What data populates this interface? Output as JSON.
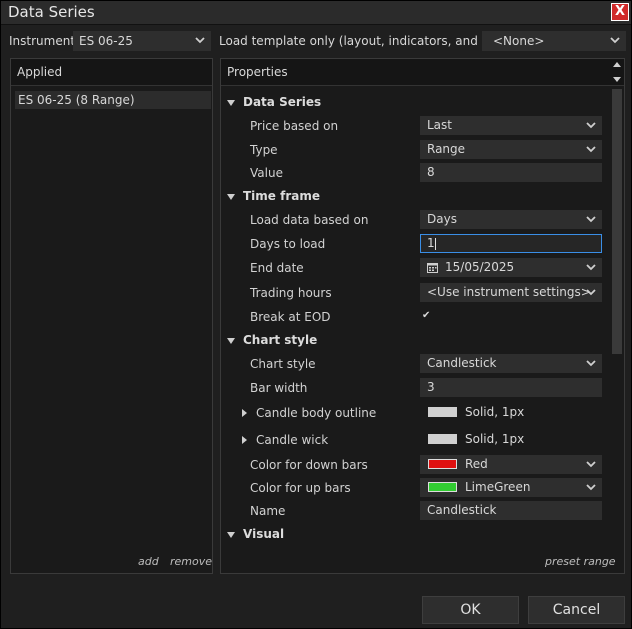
{
  "window": {
    "title": "Data Series",
    "close_glyph": "X"
  },
  "top": {
    "instrument_label": "Instrument",
    "instrument_value": "ES 06-25",
    "template_label": "Load template only (layout, indicators, and style)",
    "template_value": "<None>"
  },
  "applied": {
    "header": "Applied",
    "items": [
      "ES 06-25 (8 Range)"
    ],
    "add_label": "add",
    "remove_label": "remove"
  },
  "properties": {
    "header": "Properties",
    "preset_label": "preset range",
    "sections": {
      "data_series": "Data Series",
      "time_frame": "Time frame",
      "chart_style": "Chart style",
      "visual": "Visual"
    },
    "rows": {
      "price_based_on": {
        "label": "Price based on",
        "value": "Last"
      },
      "type": {
        "label": "Type",
        "value": "Range"
      },
      "value": {
        "label": "Value",
        "value": "8"
      },
      "load_data_based_on": {
        "label": "Load data based on",
        "value": "Days"
      },
      "days_to_load": {
        "label": "Days to load",
        "value": "1"
      },
      "end_date": {
        "label": "End date",
        "value": "15/05/2025"
      },
      "trading_hours": {
        "label": "Trading hours",
        "value": "<Use instrument settings>"
      },
      "break_at_eod": {
        "label": "Break at EOD",
        "value": "✔"
      },
      "chart_style": {
        "label": "Chart style",
        "value": "Candlestick"
      },
      "bar_width": {
        "label": "Bar width",
        "value": "3"
      },
      "candle_body_outline": {
        "label": "Candle body outline",
        "value": "Solid, 1px",
        "color": "#d0d0d0"
      },
      "candle_wick": {
        "label": "Candle wick",
        "value": "Solid, 1px",
        "color": "#d0d0d0"
      },
      "color_down": {
        "label": "Color for down bars",
        "value": "Red",
        "color": "#e01010"
      },
      "color_up": {
        "label": "Color for up bars",
        "value": "LimeGreen",
        "color": "#32cd32"
      },
      "name": {
        "label": "Name",
        "value": "Candlestick"
      }
    }
  },
  "buttons": {
    "ok": "OK",
    "cancel": "Cancel"
  },
  "colors": {
    "background": "#1f1f1f",
    "panel": "#1a1a1a",
    "field": "#2e2e2e",
    "focus": "#3a8ee6",
    "close": "#d02a2a"
  }
}
